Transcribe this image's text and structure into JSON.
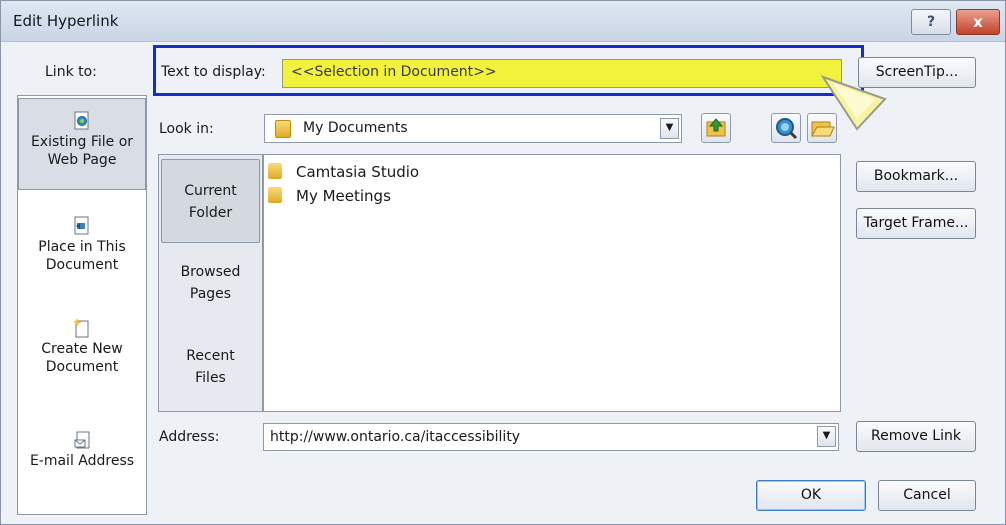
{
  "window": {
    "title": "Edit Hyperlink",
    "help_label": "?",
    "close_label": "x"
  },
  "text_to_display": {
    "label": "Text to display:",
    "value": "<<Selection in Document>>"
  },
  "screentip_button": "ScreenTip...",
  "link_to": {
    "label": "Link to:",
    "items": [
      {
        "line1": "Existing File or",
        "line2": "Web Page",
        "icon": "existing-file-icon",
        "selected": true
      },
      {
        "line1": "Place in This",
        "line2": "Document",
        "icon": "place-in-document-icon",
        "selected": false
      },
      {
        "line1": "Create New",
        "line2": "Document",
        "icon": "new-document-icon",
        "selected": false
      },
      {
        "line1": "E-mail Address",
        "line2": "",
        "icon": "email-icon",
        "selected": false
      }
    ]
  },
  "look_in": {
    "label": "Look in:",
    "value": "My Documents"
  },
  "nav": [
    {
      "line1": "Current",
      "line2": "Folder",
      "selected": true
    },
    {
      "line1": "Browsed",
      "line2": "Pages",
      "selected": false
    },
    {
      "line1": "Recent",
      "line2": "Files",
      "selected": false
    }
  ],
  "files": [
    "Camtasia Studio",
    "My Meetings"
  ],
  "buttons": {
    "bookmark": "Bookmark...",
    "target_frame": "Target Frame...",
    "remove_link": "Remove Link",
    "ok": "OK",
    "cancel": "Cancel"
  },
  "address": {
    "label": "Address:",
    "value": "http://www.ontario.ca/itaccessibility"
  },
  "colors": {
    "highlight_field": "#f2f23c",
    "highlight_border": "#1230c8"
  }
}
